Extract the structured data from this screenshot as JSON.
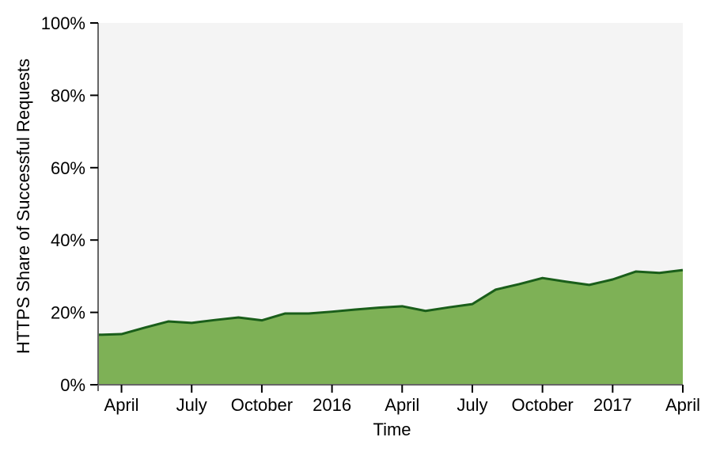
{
  "chart_data": {
    "type": "area",
    "title": "",
    "xlabel": "Time",
    "ylabel": "HTTPS Share of Successful Requests",
    "ylim": [
      0,
      100
    ],
    "y_ticks": [
      {
        "value": 0,
        "label": "0%"
      },
      {
        "value": 20,
        "label": "20%"
      },
      {
        "value": 40,
        "label": "40%"
      },
      {
        "value": 60,
        "label": "60%"
      },
      {
        "value": 80,
        "label": "80%"
      },
      {
        "value": 100,
        "label": "100%"
      }
    ],
    "x_range_months": [
      0,
      25
    ],
    "x_ticks": [
      {
        "month_index": 1,
        "label": "April"
      },
      {
        "month_index": 4,
        "label": "July"
      },
      {
        "month_index": 7,
        "label": "October"
      },
      {
        "month_index": 10,
        "label": "2016"
      },
      {
        "month_index": 13,
        "label": "April"
      },
      {
        "month_index": 16,
        "label": "July"
      },
      {
        "month_index": 19,
        "label": "October"
      },
      {
        "month_index": 22,
        "label": "2017"
      },
      {
        "month_index": 25,
        "label": "April"
      }
    ],
    "x": [
      "2015-03",
      "2015-04",
      "2015-05",
      "2015-06",
      "2015-07",
      "2015-08",
      "2015-09",
      "2015-10",
      "2015-11",
      "2015-12",
      "2016-01",
      "2016-02",
      "2016-03",
      "2016-04",
      "2016-05",
      "2016-06",
      "2016-07",
      "2016-08",
      "2016-09",
      "2016-10",
      "2016-11",
      "2016-12",
      "2017-01",
      "2017-02",
      "2017-03",
      "2017-04"
    ],
    "series": [
      {
        "name": "HTTPS share",
        "values": [
          13.8,
          14.0,
          15.8,
          17.5,
          17.1,
          17.9,
          18.6,
          17.8,
          19.7,
          19.7,
          20.2,
          20.8,
          21.3,
          21.7,
          20.4,
          21.4,
          22.3,
          26.3,
          27.8,
          29.5,
          28.5,
          27.6,
          29.1,
          31.3,
          30.9,
          31.7
        ],
        "fill_color": "#7eb156",
        "line_color": "#1a5e1a"
      }
    ],
    "plot_background": "#f4f4f4",
    "grid": false,
    "legend": "none"
  }
}
